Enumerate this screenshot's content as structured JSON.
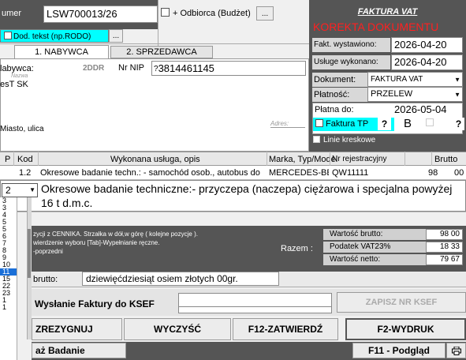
{
  "header": {
    "numer_label": "umer",
    "numer_value": "LSW700013/26",
    "odbiorca_label": "+ Odbiorca (Budżet)",
    "odbiorca_btn": "...",
    "dod_tekst": "Dod. tekst (np.RODO)",
    "dod_btn": "...",
    "tab1": "1. NABYWCA",
    "tab2": "2. SPRZEDAWCA"
  },
  "nabywca": {
    "label": "labywca:",
    "code": "2DDR",
    "nip_label": "Nr NIP",
    "nip_q": "?",
    "nip_value": "3814461145",
    "nazwa_hint": "Nazwa",
    "name": "esT SK",
    "adres_hint": "Adres:",
    "miasto_label": "Miasto, ulica"
  },
  "faktura": {
    "title": "FAKTURA VAT",
    "korekta": "KOREKTA DOKUMENTU",
    "wystawiono_label": "Fakt. wystawiono:",
    "wystawiono_value": "2026-04-20",
    "wykonano_label": "Usługe wykonano:",
    "wykonano_value": "2026-04-20",
    "dokument_label": "Dokument:",
    "dokument_value": "FAKTURA VAT",
    "platnosc_label": "Płatność:",
    "platnosc_value": "PRZELEW",
    "platna_label": "Płatna do:",
    "platna_value": "2026-05-04",
    "tp_label": "Faktura TP",
    "tp_q": "?",
    "b_label": "B",
    "fp_label": "FP",
    "fp_q": "?",
    "linie_label": "Linie kreskowe"
  },
  "table": {
    "headers": [
      "P",
      "Kod",
      "Wykonana usługa, opis",
      "Marka, Typ/Model",
      "Nr rejestracyjny",
      "Brutto"
    ],
    "row1": [
      "1.2",
      "Okresowe badanie techn.: - samochód osob., autobus do",
      "MERCEDES-BENZ/ 12",
      "QW11111",
      "98",
      "00"
    ],
    "edit_code": "2",
    "edit_text": "Okresowe badanie techniczne:- przyczepa (naczepa) ciężarowa i specjalna powyżej 16 t d.m.c."
  },
  "side_list": [
    "3",
    "3",
    "4",
    "5",
    "5",
    "6",
    "7",
    "8",
    "9",
    "10",
    "11",
    "15",
    "22",
    "23",
    "1",
    "1"
  ],
  "help": {
    "line1": "zycji z CENNIKA. Strzałka w dół,w górę ( kolejne pozycje ).",
    "line2": "wierdzenie wyboru [Tab]-Wypełnianie ręczne.",
    "line3": "-poprzedni"
  },
  "totals": {
    "razem_label": "Razem :",
    "brutto_label": "Wartość brutto:",
    "brutto_value": "98 00",
    "vat_label": "Podatek VAT23%",
    "vat_value": "18 33",
    "netto_label": "Wartość netto:",
    "netto_value": "79 67"
  },
  "slownie": {
    "label": "brutto:",
    "value": "dziewięćdziesiąt osiem złotych  00gr."
  },
  "ksef": {
    "label": "Wysłanie Faktury do KSEF",
    "zapisz": "ZAPISZ NR KSEF"
  },
  "actions": {
    "zrezygnuj": "ZREZYGNUJ",
    "wyczysc": "WYCZYŚĆ",
    "zatwierdz": "F12-ZATWIERDŹ",
    "wydruk": "F2-WYDRUK",
    "badanie": "aż Badanie",
    "podglad": "F11 - Podgląd",
    "print_icon": "printer-icon"
  }
}
